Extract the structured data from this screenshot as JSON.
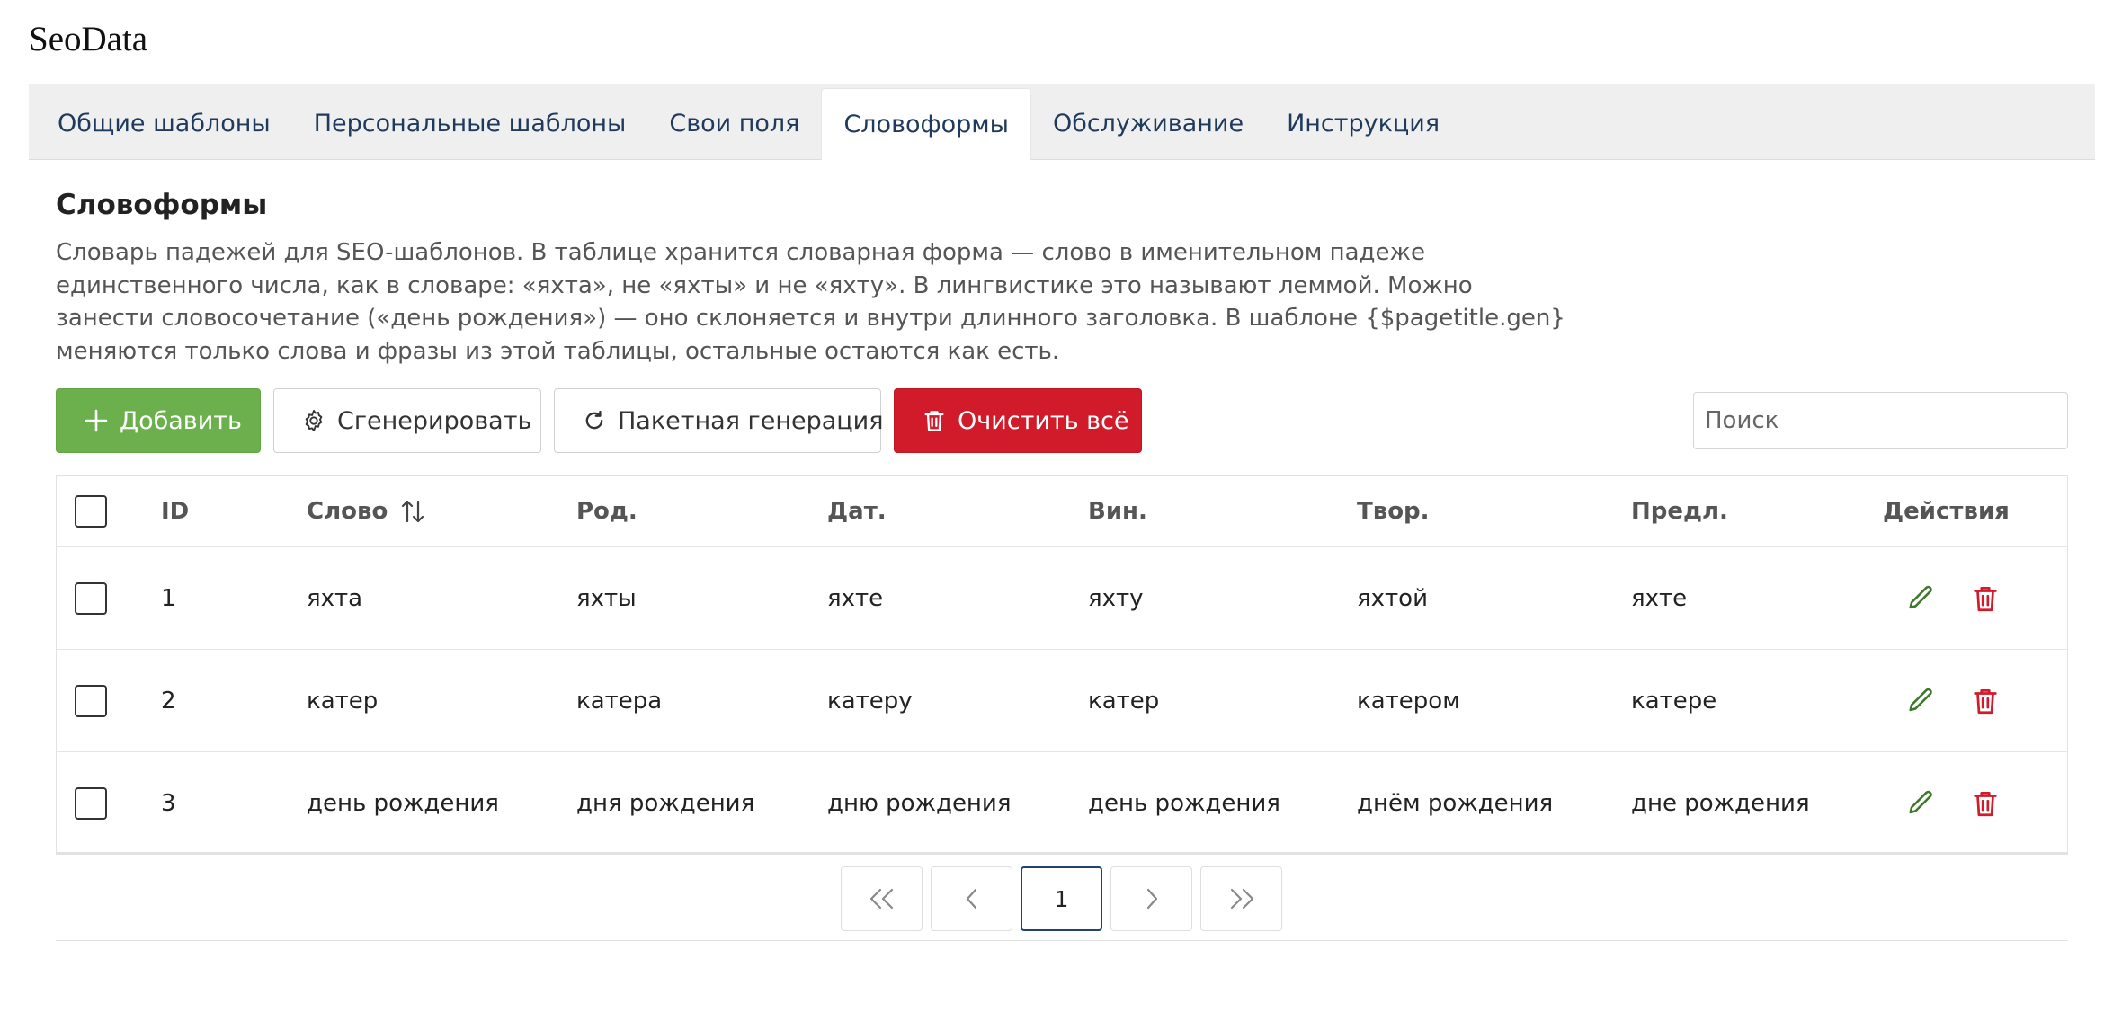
{
  "app": {
    "title": "SeoData"
  },
  "tabs": [
    {
      "label": "Общие шаблоны",
      "active": false
    },
    {
      "label": "Персональные шаблоны",
      "active": false
    },
    {
      "label": "Свои поля",
      "active": false
    },
    {
      "label": "Словоформы",
      "active": true
    },
    {
      "label": "Обслуживание",
      "active": false
    },
    {
      "label": "Инструкция",
      "active": false
    }
  ],
  "section": {
    "title": "Словоформы",
    "description": "Словарь падежей для SEO-шаблонов. В таблице хранится словарная форма — слово в именительном падеже единственного числа, как в словаре: «яхта», не «яхты» и не «яхту». В лингвистике это называют леммой. Можно занести словосочетание («день рождения») — оно склоняется и внутри длинного заголовка. В шаблоне {$pagetitle.gen} меняются только слова и фразы из этой таблицы, остальные остаются как есть."
  },
  "toolbar": {
    "add_label": "Добавить",
    "generate_label": "Сгенерировать",
    "batch_label": "Пакетная генерация",
    "clear_label": "Очистить всё"
  },
  "search": {
    "placeholder": "Поиск",
    "value": ""
  },
  "table": {
    "columns": {
      "id": "ID",
      "word": "Слово",
      "gen": "Род.",
      "dat": "Дат.",
      "acc": "Вин.",
      "ins": "Твор.",
      "pre": "Предл.",
      "actions": "Действия"
    },
    "sort_icon": "sort-arrows-icon",
    "rows": [
      {
        "id": "1",
        "word": "яхта",
        "gen": "яхты",
        "dat": "яхте",
        "acc": "яхту",
        "ins": "яхтой",
        "pre": "яхте"
      },
      {
        "id": "2",
        "word": "катер",
        "gen": "катера",
        "dat": "катеру",
        "acc": "катер",
        "ins": "катером",
        "pre": "катере"
      },
      {
        "id": "3",
        "word": "день рождения",
        "gen": "дня рождения",
        "dat": "дню рождения",
        "acc": "день рождения",
        "ins": "днём рождения",
        "pre": "дне рождения"
      }
    ]
  },
  "pagination": {
    "current_page": "1"
  },
  "colors": {
    "add": "#6bb04d",
    "clear": "#d11a2a",
    "edit_icon": "#3c7a2a",
    "delete_icon": "#d11a2a",
    "tab_text": "#1f3a5c"
  }
}
